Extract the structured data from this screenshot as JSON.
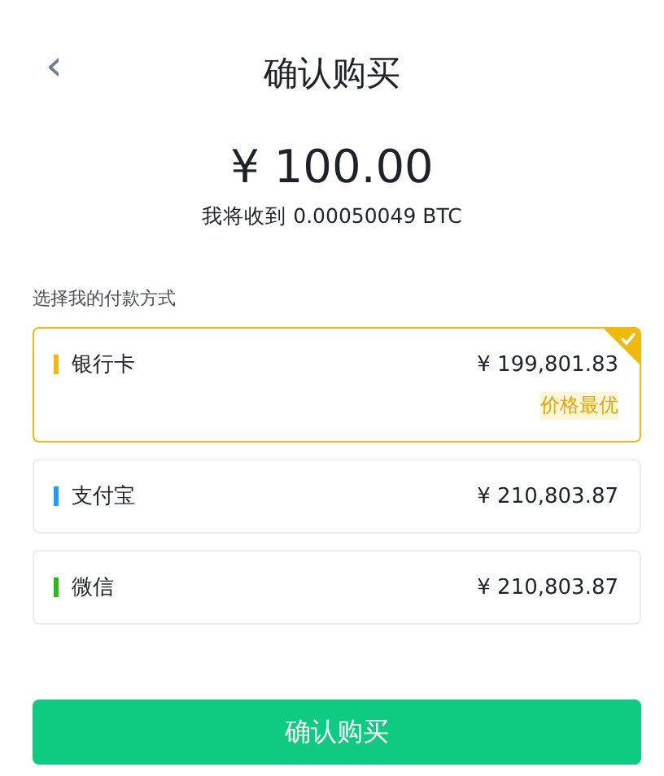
{
  "header": {
    "back": "‹",
    "title": "确认购买"
  },
  "amount": "¥ 100.00",
  "receive": "我将收到 0.00050049 BTC",
  "section_label": "选择我的付款方式",
  "methods": [
    {
      "name": "银行卡",
      "price": "¥ 199,801.83",
      "badge": "价格最优",
      "color": "#f0b90b",
      "selected": true
    },
    {
      "name": "支付宝",
      "price": "¥ 210,803.87",
      "color": "#1da1f2",
      "selected": false
    },
    {
      "name": "微信",
      "price": "¥ 210,803.87",
      "color": "#2dbb1b",
      "selected": false
    }
  ],
  "confirm_button": "确认购买"
}
